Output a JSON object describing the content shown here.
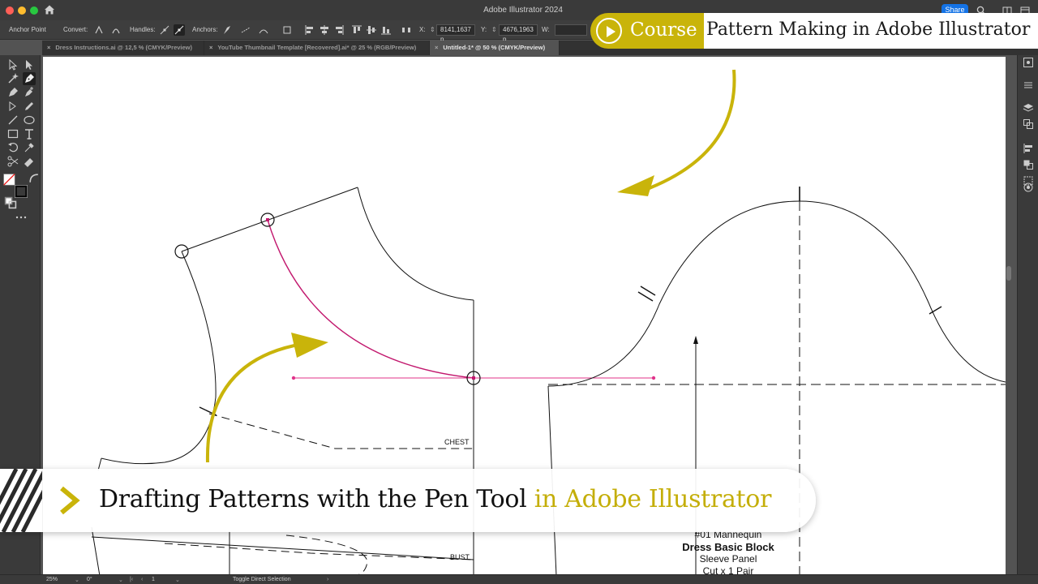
{
  "window": {
    "title": "Adobe Illustrator 2024",
    "share_label": "Share"
  },
  "control_bar": {
    "tool_name": "Anchor Point",
    "convert_label": "Convert:",
    "handles_label": "Handles:",
    "anchors_label": "Anchors:",
    "x_label": "X:",
    "x_value": "8141,1637 p",
    "y_label": "Y:",
    "y_value": "4676,1963 p",
    "w_label": "W:"
  },
  "tabs": [
    {
      "label": "Dress Instructions.ai @ 12,5 % (CMYK/Preview)",
      "active": false
    },
    {
      "label": "YouTube Thumbnail Template [Recovered].ai* @ 25 % (RGB/Preview)",
      "active": false
    },
    {
      "label": "Untitled-1* @ 50 % (CMYK/Preview)",
      "active": true
    }
  ],
  "canvas": {
    "label_chest": "CHEST",
    "label_bust": "BUST",
    "block_line1": "#01 Mannequin",
    "block_line2": "Dress Basic Block",
    "block_line3": "Sleeve Panel",
    "block_line4": "Cut x 1 Pair"
  },
  "status_bar": {
    "zoom": "25%",
    "rotation": "0°",
    "artboard": "1",
    "hint": "Toggle Direct Selection"
  },
  "overlay": {
    "course_label": "Course",
    "course_title": "Pattern Making in Adobe Illustrator",
    "headline_main": "Drafting Patterns with the Pen Tool",
    "headline_accent": "in Adobe Illustrator"
  },
  "colors": {
    "accent_yellow": "#c9b40a",
    "path_magenta": "#c2186e",
    "handle_magenta": "#e0338a"
  }
}
